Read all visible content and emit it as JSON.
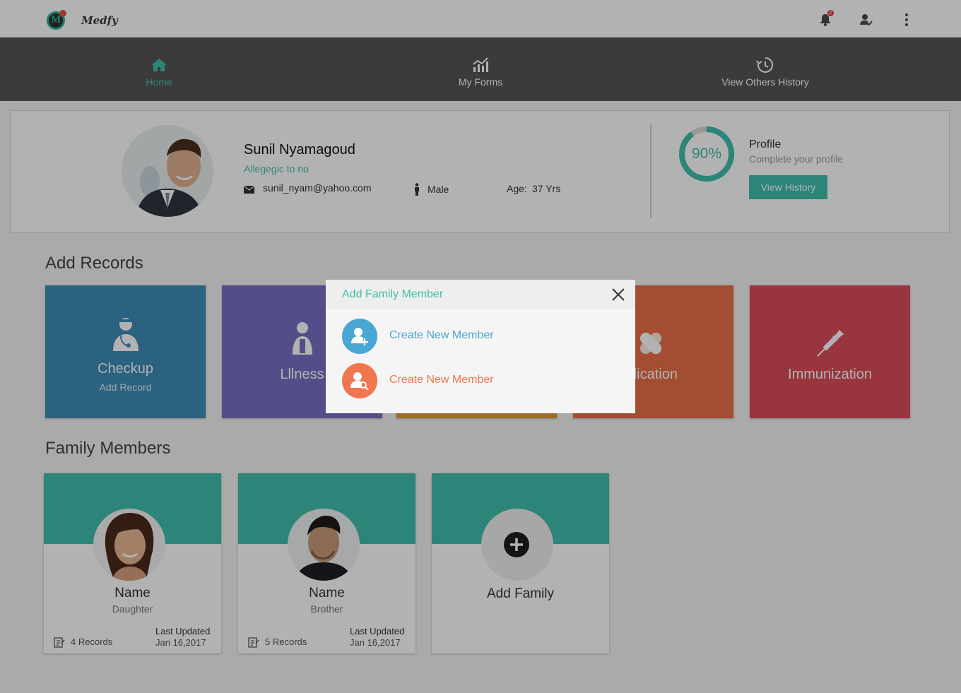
{
  "app": {
    "brand": "Medfy",
    "notification_count": "2"
  },
  "nav": {
    "items": [
      {
        "label": "Home",
        "icon": "home-icon",
        "active": true
      },
      {
        "label": "My Forms",
        "icon": "chart-icon",
        "active": false
      },
      {
        "label": "View Others History",
        "icon": "history-icon",
        "active": false
      }
    ]
  },
  "profile": {
    "name": "Sunil Nyamagoud",
    "allergy": "Allegegic to no",
    "email": "sunil_nyam@yahoo.com",
    "gender": "Male",
    "age_label": "Age:",
    "age_value": "37 Yrs",
    "completion_text": "90%",
    "completion_fraction": 0.9,
    "card_title": "Profile",
    "card_subtitle": "Complete your profile",
    "history_button": "View History"
  },
  "records": {
    "title": "Add Records",
    "tiles": [
      {
        "label": "Checkup",
        "sub": "Add Record",
        "color": "#3d8db8",
        "icon": "doctor-icon"
      },
      {
        "label": "Lllness",
        "color": "#7770c4",
        "icon": "patient-icon"
      },
      {
        "label": "",
        "color": "#e49a3c",
        "icon": ""
      },
      {
        "label": "dication",
        "color": "#ea7048",
        "icon": "pills-icon"
      },
      {
        "label": "Immunization",
        "color": "#dc4d5a",
        "icon": "syringe-icon"
      }
    ]
  },
  "family": {
    "title": "Family Members",
    "members": [
      {
        "name": "Name",
        "relation": "Daughter",
        "records": "4 Records",
        "updated_label": "Last Updated",
        "updated_date": "Jan 16,2017"
      },
      {
        "name": "Name",
        "relation": "Brother",
        "records": "5 Records",
        "updated_label": "Last Updated",
        "updated_date": "Jan 16,2017"
      }
    ],
    "add_label": "Add Family"
  },
  "modal": {
    "title": "Add Family Member",
    "options": [
      {
        "label": "Create New Member",
        "color": "#4aa6d2",
        "icon": "add-user-icon"
      },
      {
        "label": "Create New Member",
        "color": "#f0764f",
        "icon": "search-user-icon"
      }
    ]
  },
  "colors": {
    "accent": "#3fbfad",
    "nav_bg": "#555555"
  }
}
